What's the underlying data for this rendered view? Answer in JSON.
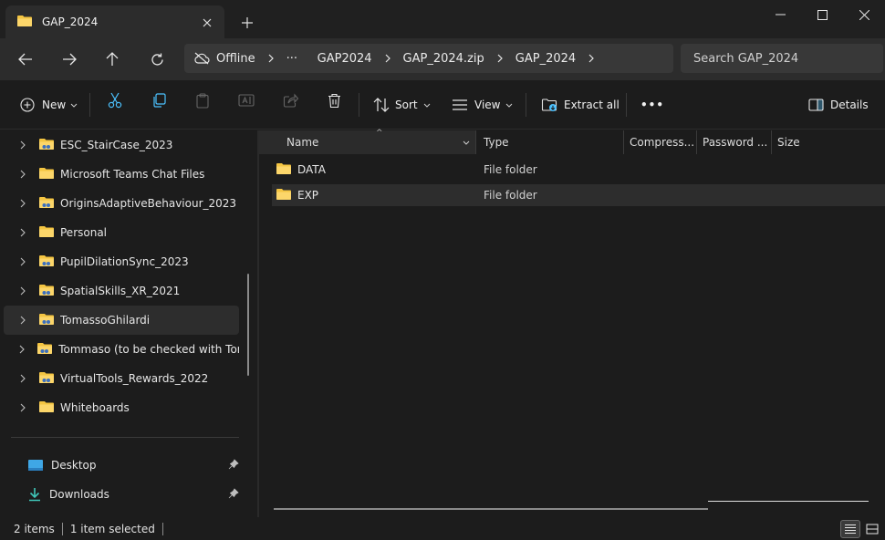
{
  "window": {
    "tab_title": "GAP_2024",
    "close_tab_icon": "close-icon",
    "new_tab_icon": "plus-icon"
  },
  "nav": {
    "breadcrumbs": [
      "Offline",
      "GAP2024",
      "GAP_2024.zip",
      "GAP_2024"
    ],
    "overflow": "···",
    "search_placeholder": "Search GAP_2024"
  },
  "commands": {
    "new_label": "New",
    "sort_label": "Sort",
    "view_label": "View",
    "extract_label": "Extract all",
    "more_label": "•••",
    "details_label": "Details"
  },
  "sidebar": {
    "items": [
      {
        "label": "ESC_StairCase_2023",
        "shared": true
      },
      {
        "label": "Microsoft Teams Chat Files",
        "shared": false
      },
      {
        "label": "OriginsAdaptiveBehaviour_2023",
        "shared": true
      },
      {
        "label": "Personal",
        "shared": false
      },
      {
        "label": "PupilDilationSync_2023",
        "shared": true
      },
      {
        "label": "SpatialSkills_XR_2021",
        "shared": true
      },
      {
        "label": "TomassoGhilardi",
        "shared": true,
        "selected": true
      },
      {
        "label": "Tommaso (to be checked with Tomma",
        "shared": true
      },
      {
        "label": "VirtualTools_Rewards_2022",
        "shared": true
      },
      {
        "label": "Whiteboards",
        "shared": false
      }
    ],
    "quick_access": [
      {
        "label": "Desktop"
      },
      {
        "label": "Downloads"
      }
    ]
  },
  "columns": [
    "Name",
    "Type",
    "Compress...",
    "Password ...",
    "Size"
  ],
  "files": [
    {
      "name": "DATA",
      "type": "File folder"
    },
    {
      "name": "EXP",
      "type": "File folder",
      "selected": true
    }
  ],
  "status": {
    "item_count": "2 items",
    "selection": "1 item selected"
  },
  "colors": {
    "folder": "#f4c542",
    "accent": "#4cc2ff",
    "selection": "#2d2d2d"
  }
}
